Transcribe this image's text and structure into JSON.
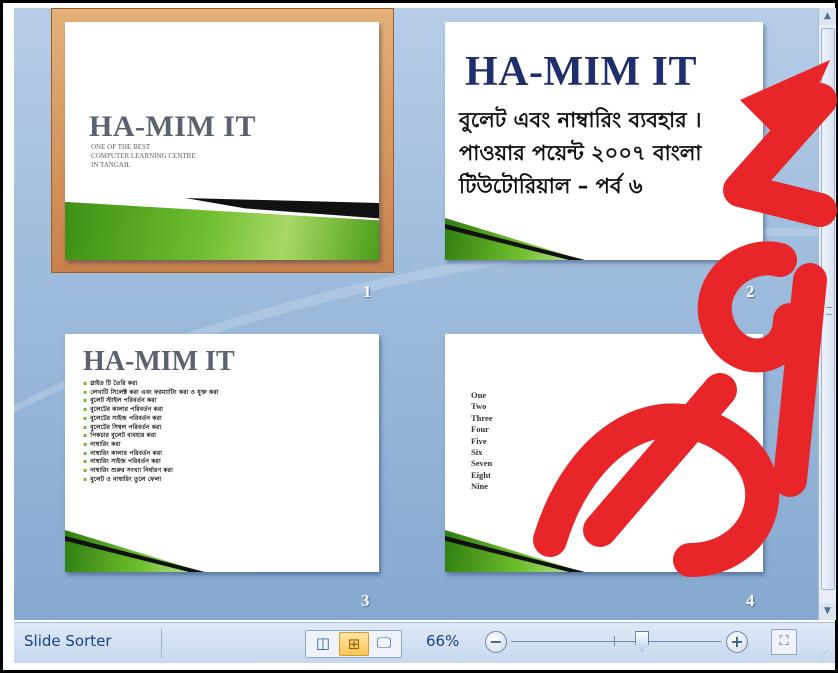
{
  "slides": [
    {
      "number": "1",
      "title": "HA-MIM IT",
      "subtitle_lines": [
        "ONE OF THE BEST",
        "COMPUTER LEARNING CENTRE",
        "IN TANGAIL"
      ]
    },
    {
      "number": "2",
      "title": "HA-MIM IT",
      "body_lines": [
        "বুলেট এবং নাম্বারিং ব্যবহার ।",
        "পাওয়ার পয়েন্ট ২০০৭ বাংলা",
        "টিউটোরিয়াল – পর্ব ৬"
      ]
    },
    {
      "number": "3",
      "title": "HA-MIM IT",
      "bullets": [
        "স্লাইড টি তৈরি করা",
        "লেখাটি সিলেক্ট করা এবং ফরম্যাটিং করা ও যুক্ত করা",
        "বুলেট স্টাইল পরিবর্তন করা",
        "বুলেটের কালার পরিবর্তন করা",
        "বুলেটের সাইজ পরিবর্তন করা",
        "বুলেটের সিম্বল পরিবর্তন করা",
        "পিকচার বুলেট ব্যবহার করা",
        "নাম্বারিং করা",
        "নাম্বারিং কালার পরিবর্তন করা",
        "নাম্বারিং সাইজ পরিবর্তন করা",
        "নাম্বারিং শুরুর সংখ্যা নির্ধারণ করা",
        "বুলেট ও নাম্বারিং তুলে ফেলা"
      ]
    },
    {
      "number": "4",
      "numbered_items": [
        "One",
        "Two",
        "Three",
        "Four",
        "Five",
        "Six",
        "Seven",
        "Eight",
        "Nine"
      ]
    }
  ],
  "status_bar": {
    "view_label": "Slide Sorter",
    "zoom_level": "66%",
    "zoom_fraction": 0.62
  },
  "icons": {
    "normal_view": "normal-view-icon",
    "slide_sorter_view": "slide-sorter-icon",
    "slide_show_view": "slide-show-icon",
    "zoom_out": "zoom-out-icon",
    "zoom_in": "zoom-in-icon",
    "fit_to_window": "fit-window-icon"
  },
  "colors": {
    "selection_border": "#c8804a",
    "title_blue": "#1f2f6b",
    "title_gray": "#5a6270",
    "watermark_red": "#e8262a",
    "status_text": "#15428b"
  }
}
